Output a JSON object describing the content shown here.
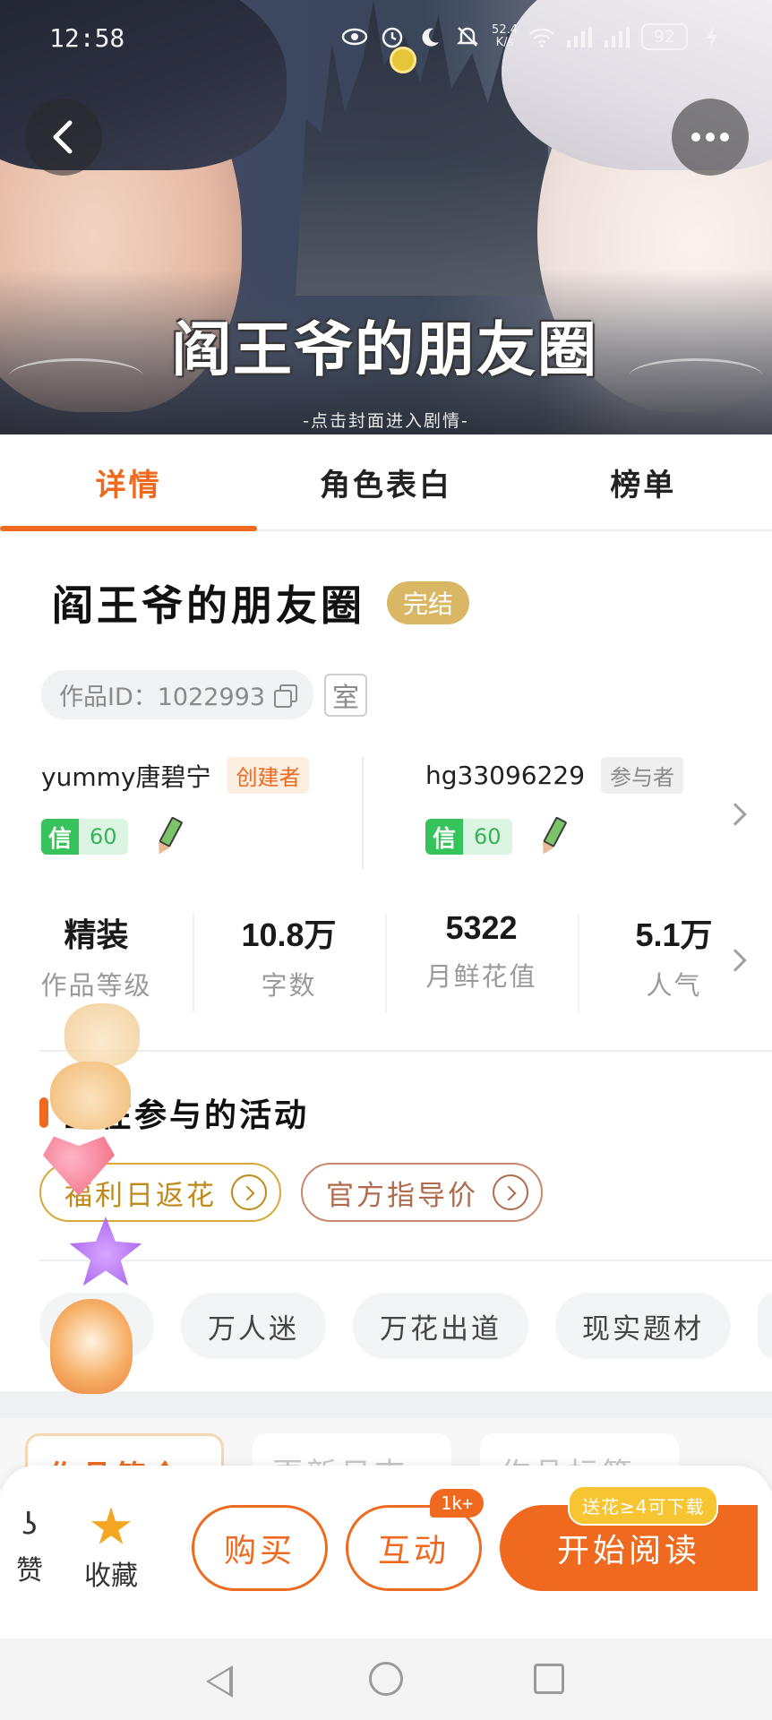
{
  "status_bar": {
    "time": "12:58",
    "net_speed_value": "52.4",
    "net_speed_unit": "K/s",
    "battery": "92",
    "network_type": "6"
  },
  "cover": {
    "logo_text": "阎王爷的朋友圈",
    "hint": "-点击封面进入剧情-"
  },
  "tabs": [
    {
      "label": "详情",
      "active": true
    },
    {
      "label": "角色表白",
      "active": false
    },
    {
      "label": "榜单",
      "active": false
    }
  ],
  "work": {
    "title": "阎王爷的朋友圈",
    "status_badge": "完结",
    "id_text": "作品ID：1022993",
    "room_label": "室"
  },
  "authors": [
    {
      "name": "yummy唐碧宁",
      "role": "创建者",
      "credit_key": "信",
      "credit_value": "60"
    },
    {
      "name": "hg33096229",
      "role": "参与者",
      "credit_key": "信",
      "credit_value": "60"
    }
  ],
  "stats": [
    {
      "value": "精装",
      "label": "作品等级"
    },
    {
      "value": "10.8万",
      "label": "字数"
    },
    {
      "value": "5322",
      "label": "月鲜花值"
    },
    {
      "value": "5.1万",
      "label": "人气"
    }
  ],
  "activities": {
    "title": "正在参与的活动",
    "items": [
      "福利日返花",
      "官方指导价"
    ]
  },
  "tags": [
    "现代",
    "万人迷",
    "万花出道",
    "现实题材"
  ],
  "lower_tabs": [
    "作品简介",
    "更新日志",
    "作品标签"
  ],
  "bottom_bar": {
    "like_label": "赞",
    "favorite_label": "收藏",
    "buy_label": "购买",
    "interact_label": "互动",
    "interact_badge": "1k+",
    "read_label": "开始阅读",
    "read_badge": "送花≥4可下载"
  },
  "colors": {
    "accent": "#ef6a1f",
    "badge_gold": "#d9b765",
    "credit_green": "#36c35b",
    "star_gold": "#f5a623"
  }
}
